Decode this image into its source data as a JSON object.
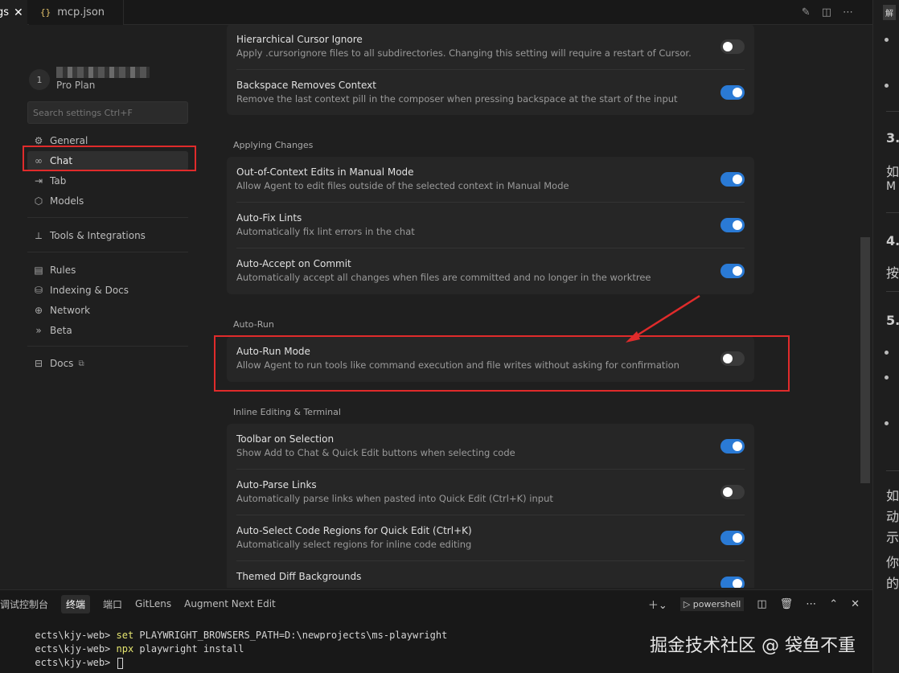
{
  "tabs": {
    "active": {
      "label": "gs",
      "close": "✕"
    },
    "second": {
      "icon": "{}",
      "label": "mcp.json"
    }
  },
  "tabbar_icons": [
    "edit-icon",
    "split-editor-icon",
    "more-icon"
  ],
  "user": {
    "avatar_text": "1",
    "plan": "Pro Plan"
  },
  "search": {
    "placeholder": "Search settings Ctrl+F"
  },
  "nav": {
    "general": {
      "label": "General",
      "icon": "⚙"
    },
    "chat": {
      "label": "Chat",
      "icon": "∞"
    },
    "tab": {
      "label": "Tab",
      "icon": "⇥"
    },
    "models": {
      "label": "Models",
      "icon": "⬡"
    },
    "tools": {
      "label": "Tools & Integrations",
      "icon": "⟂"
    },
    "rules": {
      "label": "Rules",
      "icon": "▤"
    },
    "indexing": {
      "label": "Indexing & Docs",
      "icon": "⛁"
    },
    "network": {
      "label": "Network",
      "icon": "⊕"
    },
    "beta": {
      "label": "Beta",
      "icon": "»"
    },
    "docs": {
      "label": "Docs",
      "icon": "⊟",
      "ext": "⧉"
    }
  },
  "settings": {
    "group0": {
      "rows": [
        {
          "title": "Hierarchical Cursor Ignore",
          "desc": "Apply .cursorignore files to all subdirectories. Changing this setting will require a restart of Cursor.",
          "on": false
        },
        {
          "title": "Backspace Removes Context",
          "desc": "Remove the last context pill in the composer when pressing backspace at the start of the input",
          "on": true
        }
      ]
    },
    "applying": {
      "heading": "Applying Changes",
      "rows": [
        {
          "title": "Out-of-Context Edits in Manual Mode",
          "desc": "Allow Agent to edit files outside of the selected context in Manual Mode",
          "on": true
        },
        {
          "title": "Auto-Fix Lints",
          "desc": "Automatically fix lint errors in the chat",
          "on": true
        },
        {
          "title": "Auto-Accept on Commit",
          "desc": "Automatically accept all changes when files are committed and no longer in the worktree",
          "on": true
        }
      ]
    },
    "autorun": {
      "heading": "Auto-Run",
      "rows": [
        {
          "title": "Auto-Run Mode",
          "desc": "Allow Agent to run tools like command execution and file writes without asking for confirmation",
          "on": false
        }
      ]
    },
    "inline": {
      "heading": "Inline Editing & Terminal",
      "rows": [
        {
          "title": "Toolbar on Selection",
          "desc": "Show Add to Chat & Quick Edit buttons when selecting code",
          "on": true
        },
        {
          "title": "Auto-Parse Links",
          "desc": "Automatically parse links when pasted into Quick Edit (Ctrl+K) input",
          "on": false
        },
        {
          "title": "Auto-Select Code Regions for Quick Edit (Ctrl+K)",
          "desc": "Automatically select regions for inline code editing",
          "on": true
        },
        {
          "title": "Themed Diff Backgrounds",
          "desc": "",
          "on": true
        }
      ]
    }
  },
  "right_panel": {
    "badge": "解",
    "lines": [
      "3.",
      "如",
      "M",
      "4.",
      "按",
      "5.",
      "如",
      "动",
      "示",
      "你",
      "的"
    ]
  },
  "terminal": {
    "tabs": [
      "调试控制台",
      "终端",
      "端口",
      "GitLens",
      "Augment Next Edit"
    ],
    "active_tab": "终端",
    "shell": "powershell",
    "lines": [
      {
        "prompt": "ects\\kjy-web> ",
        "cmd": "set",
        "rest": " PLAYWRIGHT_BROWSERS_PATH=D:\\newprojects\\ms-playwright"
      },
      {
        "prompt": "ects\\kjy-web> ",
        "cmd": "npx",
        "rest": " playwright install"
      },
      {
        "prompt": "ects\\kjy-web> ",
        "cmd": "",
        "rest": ""
      }
    ]
  },
  "watermark": "掘金技术社区 @ 袋鱼不重",
  "colors": {
    "toggle_on": "#2a7ad5",
    "toggle_off": "#3a3a3a",
    "highlight_box": "#e02b2b",
    "terminal_cmd": "#e5e56f"
  }
}
